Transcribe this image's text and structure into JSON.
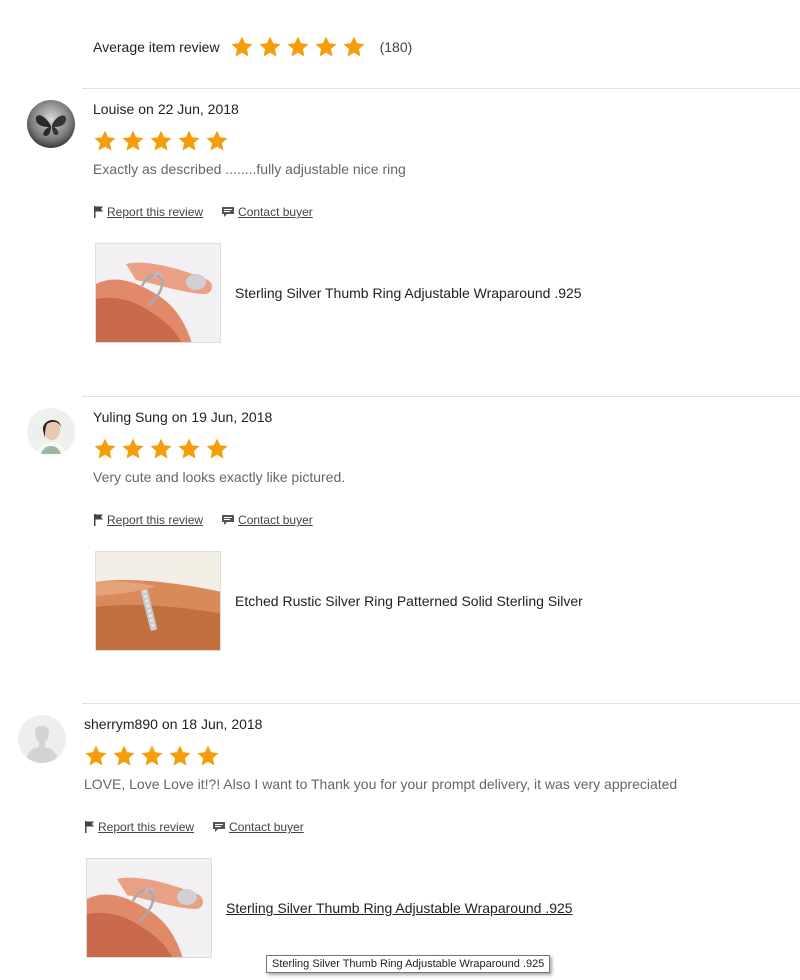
{
  "summary": {
    "label": "Average item review",
    "rating": 5,
    "count": "(180)",
    "star_color": "#f59d0b"
  },
  "reviews": [
    {
      "reviewer": "Louise",
      "on": "on",
      "date": "22 Jun, 2018",
      "rating": 5,
      "text": "Exactly as described ........fully adjustable nice ring",
      "report_label": "Report this review",
      "contact_label": "Contact buyer",
      "item_title": "Sterling Silver Thumb Ring Adjustable Wraparound .925",
      "avatar_icon": "butterfly-avatar-icon",
      "thumb_icon": "thumb-ring-photo"
    },
    {
      "reviewer": "Yuling Sung",
      "on": "on",
      "date": "19 Jun, 2018",
      "rating": 5,
      "text": "Very cute and looks exactly like pictured.",
      "report_label": "Report this review",
      "contact_label": "Contact buyer",
      "item_title": "Etched Rustic Silver Ring Patterned Solid Sterling Silver",
      "avatar_icon": "person-photo-avatar-icon",
      "thumb_icon": "etched-ring-photo"
    },
    {
      "reviewer": "sherrym890",
      "on": "on",
      "date": "18 Jun, 2018",
      "rating": 5,
      "text": "LOVE, Love Love it!?! Also I want to Thank you for your prompt delivery, it was very appreciated",
      "report_label": "Report this review",
      "contact_label": "Contact buyer",
      "item_title": "Sterling Silver Thumb Ring Adjustable Wraparound .925",
      "avatar_icon": "default-user-avatar-icon",
      "thumb_icon": "thumb-ring-photo"
    }
  ],
  "tooltip": {
    "text": "Sterling Silver Thumb Ring Adjustable Wraparound .925"
  }
}
